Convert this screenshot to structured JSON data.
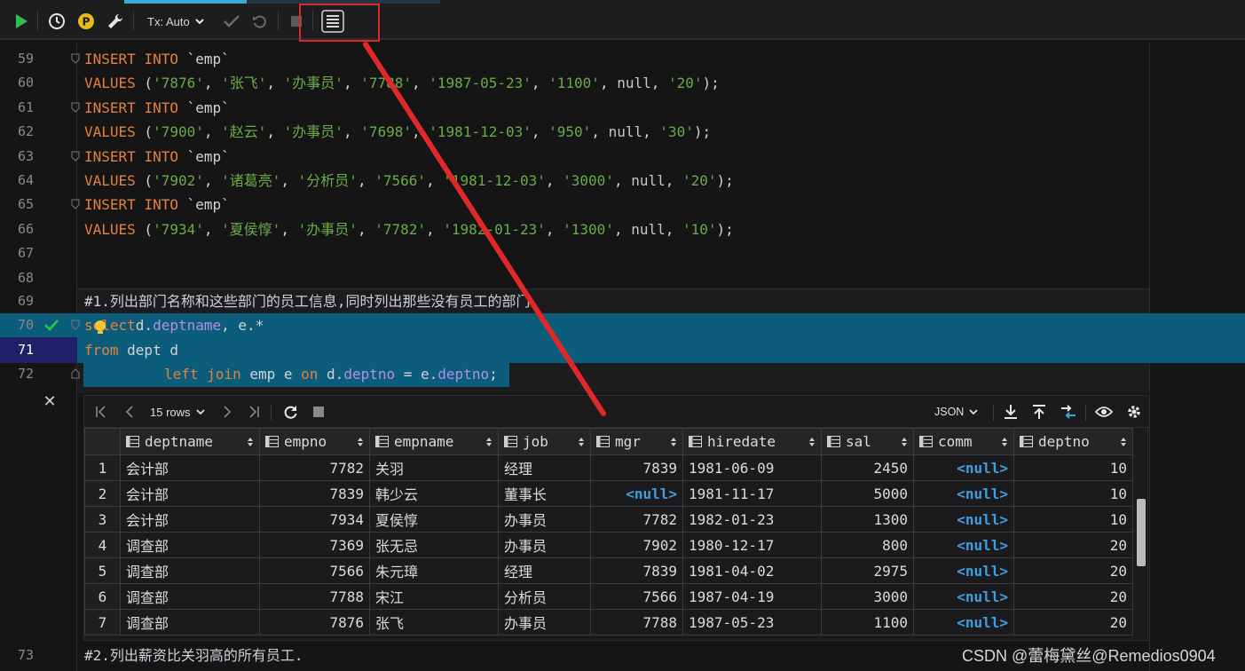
{
  "toolbar": {
    "tx_label": "Tx: Auto",
    "run_icon": "play-icon",
    "history_icon": "clock-icon",
    "profile_icon": "p-badge-icon",
    "settings_icon": "wrench-icon",
    "commit_icon": "check-icon",
    "rollback_icon": "undo-icon",
    "stop_icon": "stop-icon",
    "table_icon": "table-view-icon"
  },
  "editor": {
    "lines": [
      {
        "n": "59",
        "kind": "insert",
        "text": [
          "INSERT",
          "INTO",
          "`emp`"
        ]
      },
      {
        "n": "60",
        "kind": "values",
        "vals": [
          "'7876'",
          "'张飞'",
          "'办事员'",
          "'7788'",
          "'1987-05-23'",
          "'1100'",
          "null",
          "'20'"
        ]
      },
      {
        "n": "61",
        "kind": "insert",
        "text": [
          "INSERT",
          "INTO",
          "`emp`"
        ]
      },
      {
        "n": "62",
        "kind": "values",
        "vals": [
          "'7900'",
          "'赵云'",
          "'办事员'",
          "'7698'",
          "'1981-12-03'",
          "'950'",
          "null",
          "'30'"
        ]
      },
      {
        "n": "63",
        "kind": "insert",
        "text": [
          "INSERT",
          "INTO",
          "`emp`"
        ]
      },
      {
        "n": "64",
        "kind": "values",
        "vals": [
          "'7902'",
          "'诸葛亮'",
          "'分析员'",
          "'7566'",
          "'1981-12-03'",
          "'3000'",
          "null",
          "'20'"
        ]
      },
      {
        "n": "65",
        "kind": "insert",
        "text": [
          "INSERT",
          "INTO",
          "`emp`"
        ]
      },
      {
        "n": "66",
        "kind": "values",
        "vals": [
          "'7934'",
          "'夏侯惇'",
          "'办事员'",
          "'7782'",
          "'1982-01-23'",
          "'1300'",
          "null",
          "'10'"
        ]
      },
      {
        "n": "67",
        "kind": "blank"
      },
      {
        "n": "68",
        "kind": "blank"
      }
    ],
    "line69": {
      "n": "69",
      "comment": "#1.列出部门名称和这些部门的员工信息,同时列出那些没有员工的部门"
    },
    "line70": {
      "n": "70",
      "kw1": "select",
      "p1": "d.",
      "f1": "deptname",
      "p2": ", e.*"
    },
    "line71": {
      "n": "71",
      "kw1": "from",
      "p1": " dept d"
    },
    "line72": {
      "n": "72",
      "kw1": "left join",
      "p1": " emp e ",
      "kw2": "on",
      "p2": " d.",
      "f1": "deptno",
      "p3": " = e.",
      "f2": "deptno",
      "p4": ";"
    },
    "line73": {
      "n": "73",
      "comment": "#2.列出薪资比关羽高的所有员工."
    },
    "values_kw": "VALUES",
    "null_kw": "null"
  },
  "results": {
    "rows_label": "15 rows",
    "format_label": "JSON",
    "columns": [
      "deptname",
      "empno",
      "empname",
      "job",
      "mgr",
      "hiredate",
      "sal",
      "comm",
      "deptno"
    ],
    "rows": [
      {
        "i": "1",
        "deptname": "会计部",
        "empno": "7782",
        "empname": "关羽",
        "job": "经理",
        "mgr": "7839",
        "hiredate": "1981-06-09",
        "sal": "2450",
        "comm": "<null>",
        "deptno": "10"
      },
      {
        "i": "2",
        "deptname": "会计部",
        "empno": "7839",
        "empname": "韩少云",
        "job": "董事长",
        "mgr": "<null>",
        "hiredate": "1981-11-17",
        "sal": "5000",
        "comm": "<null>",
        "deptno": "10"
      },
      {
        "i": "3",
        "deptname": "会计部",
        "empno": "7934",
        "empname": "夏侯惇",
        "job": "办事员",
        "mgr": "7782",
        "hiredate": "1982-01-23",
        "sal": "1300",
        "comm": "<null>",
        "deptno": "10"
      },
      {
        "i": "4",
        "deptname": "调查部",
        "empno": "7369",
        "empname": "张无忌",
        "job": "办事员",
        "mgr": "7902",
        "hiredate": "1980-12-17",
        "sal": "800",
        "comm": "<null>",
        "deptno": "20"
      },
      {
        "i": "5",
        "deptname": "调查部",
        "empno": "7566",
        "empname": "朱元璋",
        "job": "经理",
        "mgr": "7839",
        "hiredate": "1981-04-02",
        "sal": "2975",
        "comm": "<null>",
        "deptno": "20"
      },
      {
        "i": "6",
        "deptname": "调查部",
        "empno": "7788",
        "empname": "宋江",
        "job": "分析员",
        "mgr": "7566",
        "hiredate": "1987-04-19",
        "sal": "3000",
        "comm": "<null>",
        "deptno": "20"
      },
      {
        "i": "7",
        "deptname": "调查部",
        "empno": "7876",
        "empname": "张飞",
        "job": "办事员",
        "mgr": "7788",
        "hiredate": "1987-05-23",
        "sal": "1100",
        "comm": "<null>",
        "deptno": "20"
      }
    ]
  },
  "watermark": "CSDN @蕾梅黛丝@Remedios0904",
  "colors": {
    "keyword": "#e4813c",
    "string": "#6aab47",
    "field": "#b38fe8",
    "selection": "#0c5d7c",
    "null_value": "#3d9fe0",
    "annotation_red": "#e0282b",
    "run_green": "#2fbf4a"
  }
}
